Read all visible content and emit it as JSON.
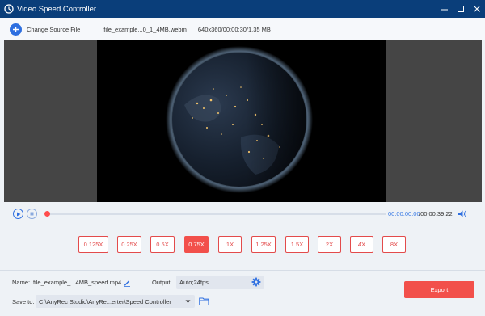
{
  "window": {
    "title": "Video Speed Controller"
  },
  "topbar": {
    "change_source": "Change Source File",
    "file_name": "file_example...0_1_4MB.webm",
    "file_info": "640x360/00:00:30/1.35 MB"
  },
  "transport": {
    "current_time": "00:00:00.00",
    "total_time": "/00:00:39.22",
    "progress": 0
  },
  "speeds": {
    "options": [
      "0.125X",
      "0.25X",
      "0.5X",
      "0.75X",
      "1X",
      "1.25X",
      "1.5X",
      "2X",
      "4X",
      "8X"
    ],
    "selected": "0.75X"
  },
  "output": {
    "name_label": "Name:",
    "name_value": "file_example_...4MB_speed.mp4",
    "output_label": "Output:",
    "output_value": "Auto;24fps",
    "save_label": "Save to:",
    "save_path": "C:\\AnyRec Studio\\AnyRe...erter\\Speed Controller",
    "export_label": "Export"
  },
  "colors": {
    "titlebar": "#0a3e7a",
    "accent": "#2e6fe0",
    "danger": "#f2504b"
  }
}
